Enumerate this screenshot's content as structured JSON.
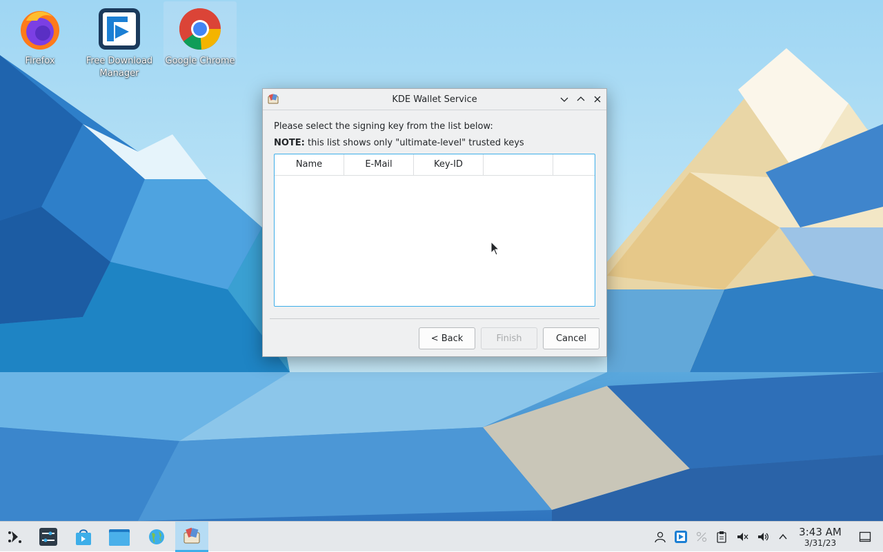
{
  "desktop": {
    "icons": [
      {
        "label": "Firefox",
        "icon": "firefox-icon"
      },
      {
        "label": "Free Download Manager",
        "icon": "free-download-manager-icon"
      },
      {
        "label": "Google Chrome",
        "icon": "google-chrome-icon"
      }
    ]
  },
  "dialog": {
    "title": "KDE Wallet Service",
    "instruction": "Please select the signing key from the list below:",
    "note_label": "NOTE:",
    "note_text": " this list shows only \"ultimate-level\" trusted keys",
    "columns": [
      "Name",
      "E-Mail",
      "Key-ID",
      ""
    ],
    "rows": [],
    "buttons": {
      "back": "< Back",
      "finish": "Finish",
      "cancel": "Cancel"
    },
    "finish_enabled": false
  },
  "taskbar": {
    "launchers": [
      "application-launcher-icon",
      "system-settings-icon",
      "discover-store-icon",
      "file-manager-icon",
      "network-globe-icon",
      "kwallet-icon"
    ],
    "tray": [
      "user-icon",
      "free-download-manager-tray-icon",
      "network-disconnected-icon",
      "clipboard-icon",
      "microphone-muted-icon",
      "volume-icon",
      "expand-tray-icon"
    ],
    "clock": {
      "time": "3:43 AM",
      "date": "3/31/23"
    },
    "show_desktop": "show-desktop-icon"
  },
  "colors": {
    "accent": "#3daee9",
    "window_bg": "#eff0f1",
    "taskbar_bg": "#e5e8eb"
  }
}
